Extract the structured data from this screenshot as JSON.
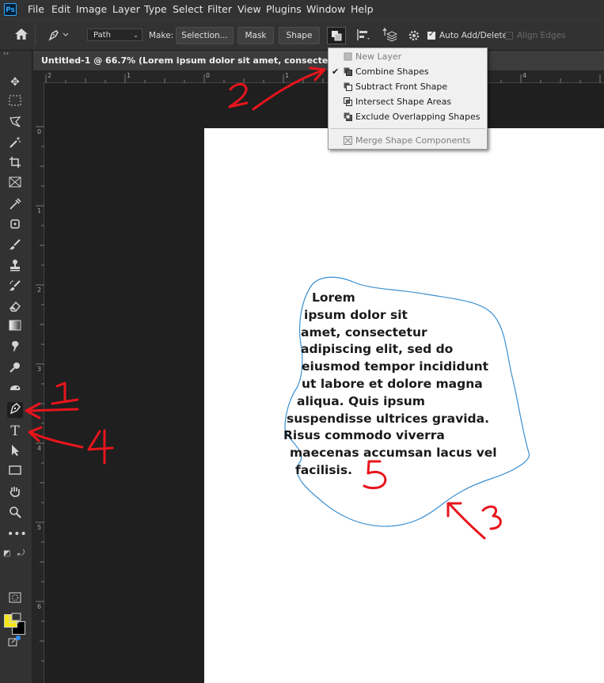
{
  "app": {
    "logo": "Ps"
  },
  "menu": [
    "File",
    "Edit",
    "Image",
    "Layer",
    "Type",
    "Select",
    "Filter",
    "View",
    "Plugins",
    "Window",
    "Help"
  ],
  "options_bar": {
    "mode_value": "Path",
    "make_label": "Make:",
    "selection_label": "Selection...",
    "mask_label": "Mask",
    "shape_label": "Shape",
    "auto_add_delete_label": "Auto Add/Delete",
    "auto_add_delete_checked": true,
    "align_edges_label": "Align Edges",
    "align_edges_checked": false
  },
  "document": {
    "tab_title": "Untitled-1 @ 66.7% (Lorem ipsum dolor sit amet, consectetur adipiscing"
  },
  "rulers": {
    "horizontal": [
      "2",
      "1",
      "0",
      "1",
      "2",
      "3",
      "4"
    ],
    "vertical": [
      "0",
      "1",
      "2",
      "3",
      "4",
      "5",
      "6"
    ]
  },
  "path_operations_menu": {
    "items": [
      {
        "label": "New Layer",
        "checked": false,
        "enabled": false
      },
      {
        "label": "Combine Shapes",
        "checked": true,
        "enabled": true
      },
      {
        "label": "Subtract Front Shape",
        "checked": false,
        "enabled": true
      },
      {
        "label": "Intersect Shape Areas",
        "checked": false,
        "enabled": true
      },
      {
        "label": "Exclude Overlapping Shapes",
        "checked": false,
        "enabled": true
      },
      {
        "label": "Merge Shape Components",
        "checked": false,
        "enabled": false
      }
    ]
  },
  "canvas_text": {
    "lines": [
      "Lorem",
      "ipsum dolor sit",
      "amet, consectetur",
      "adipiscing elit, sed do",
      "eiusmod tempor incididunt",
      "ut labore et dolore magna",
      "aliqua. Quis ipsum",
      "suspendisse ultrices gravida.",
      "Risus commodo viverra",
      "maecenas accumsan lacus vel",
      "facilisis."
    ]
  },
  "colors": {
    "foreground": "#f5e614",
    "background": "#000000",
    "annotation": "#e8141c",
    "path_outline": "#3a8fd0"
  },
  "annotations": [
    "1",
    "2",
    "3",
    "4",
    "5"
  ]
}
